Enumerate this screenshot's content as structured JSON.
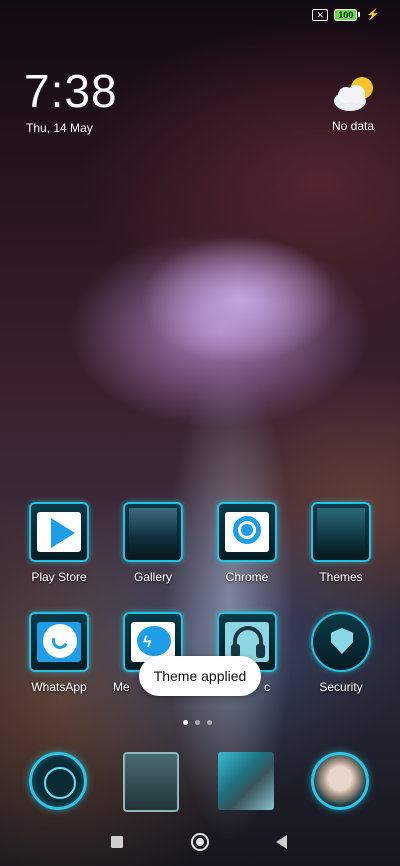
{
  "status_bar": {
    "battery_level": "100"
  },
  "lock_widget": {
    "time": "7:38",
    "date": "Thu, 14 May",
    "weather_text": "No data"
  },
  "apps": [
    {
      "label": "Play Store"
    },
    {
      "label": "Gallery"
    },
    {
      "label": "Chrome"
    },
    {
      "label": "Themes"
    },
    {
      "label": "WhatsApp"
    },
    {
      "label": "Me"
    },
    {
      "label": "c"
    },
    {
      "label": "Security"
    }
  ],
  "toast": {
    "text": "Theme applied"
  },
  "page_indicator": {
    "pages": 3,
    "active": 1
  },
  "colors": {
    "accent_cyan": "#21c3e0",
    "toast_bg": "#ffffff",
    "battery_green": "#6bd64a"
  }
}
